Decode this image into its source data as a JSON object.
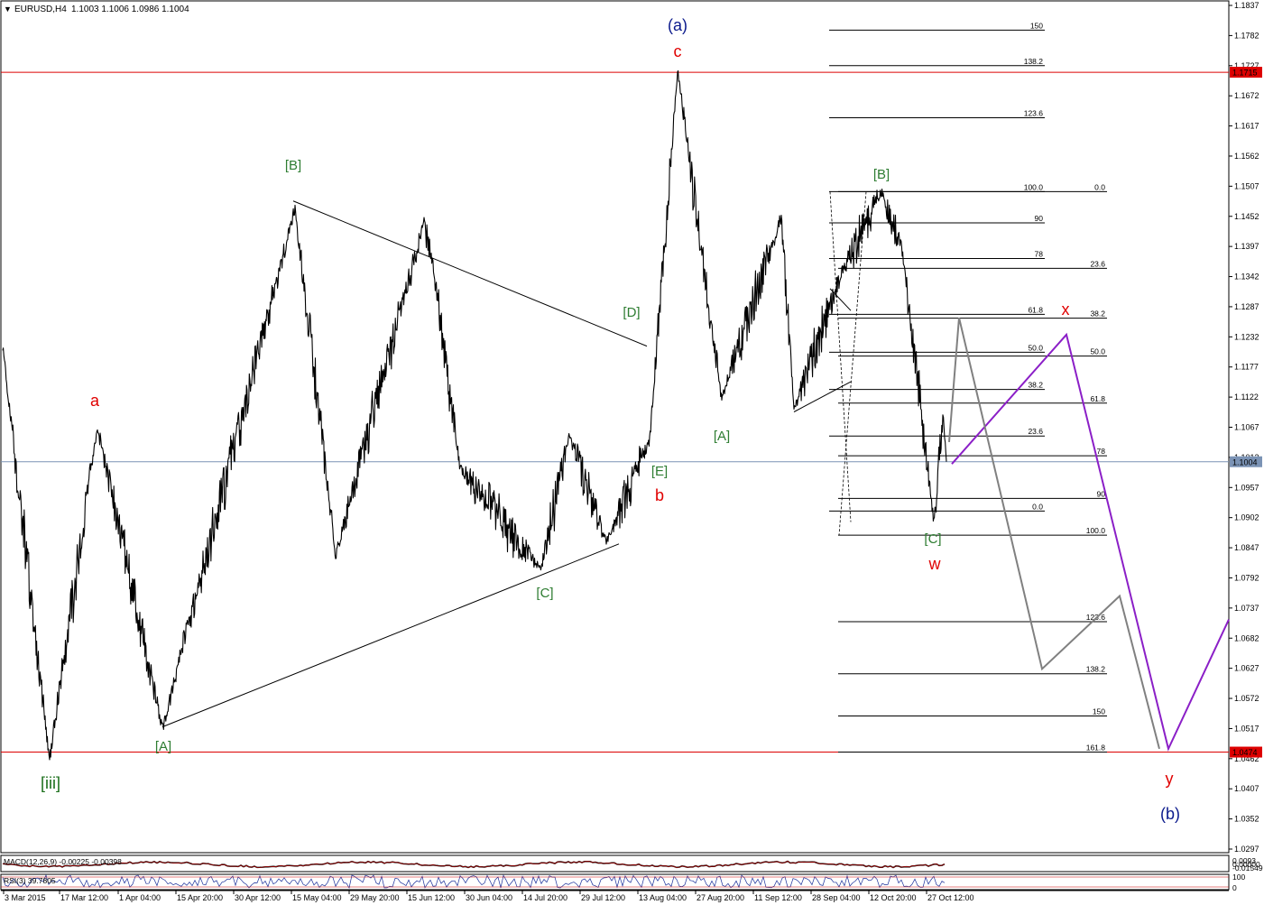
{
  "chart_title": {
    "symbol": "EURUSD,H4",
    "ohlc": "1.1003 1.1006 1.0986 1.1004"
  },
  "chart_data": {
    "type": "line",
    "symbol": "EURUSD",
    "timeframe": "H4",
    "last_price": 1.1004,
    "ylim": [
      1.0297,
      1.1837
    ],
    "price_ticks": [
      "1.1837",
      "1.1782",
      "1.1727",
      "1.1672",
      "1.1617",
      "1.1562",
      "1.1507",
      "1.1452",
      "1.1397",
      "1.1342",
      "1.1287",
      "1.1232",
      "1.1177",
      "1.1122",
      "1.1067",
      "1.1012",
      "1.0957",
      "1.0902",
      "1.0847",
      "1.0792",
      "1.0737",
      "1.0682",
      "1.0627",
      "1.0572",
      "1.0517",
      "1.0462",
      "1.0407",
      "1.0352",
      "1.0297"
    ],
    "date_ticks": [
      "3 Mar 2015",
      "17 Mar 12:00",
      "1 Apr 04:00",
      "15 Apr 20:00",
      "30 Apr 12:00",
      "15 May 04:00",
      "29 May 20:00",
      "15 Jun 12:00",
      "30 Jun 04:00",
      "14 Jul 20:00",
      "29 Jul 12:00",
      "13 Aug 04:00",
      "27 Aug 20:00",
      "11 Sep 12:00",
      "28 Sep 04:00",
      "12 Oct 20:00",
      "27 Oct 12:00"
    ],
    "series": [
      {
        "x": [
          "3 Mar 2015",
          "13 Mar",
          "27 Mar",
          "14 Apr",
          "25 Apr",
          "14 May",
          "27 May",
          "18 Jun",
          "26 Jun",
          "8 Jul",
          "20 Jul",
          "27 Jul",
          "4 Aug",
          "24 Aug",
          "28 Aug",
          "14 Sep",
          "20 Sep",
          "26 Sep",
          "12 Oct",
          "19 Oct",
          "26 Oct",
          "28 Oct",
          "30 Oct"
        ],
        "values": [
          1.1213,
          1.0462,
          1.1066,
          1.0517,
          1.1467,
          1.0832,
          1.144,
          1.138,
          1.099,
          1.081,
          1.105,
          1.086,
          1.104,
          1.1715,
          1.112,
          1.145,
          1.11,
          1.135,
          1.1495,
          1.139,
          1.0897,
          1.108,
          1.1004
        ]
      }
    ],
    "horizontal_lines": [
      {
        "price": 1.1715,
        "label": "1.1715",
        "color": "#dd0000"
      },
      {
        "price": 1.0474,
        "label": "1.0474",
        "color": "#dd0000"
      },
      {
        "price": 1.1004,
        "label": "1.1004",
        "color": "#7b93b5"
      }
    ],
    "wave_labels": [
      {
        "text": "(a)",
        "color": "#0b1a8c"
      },
      {
        "text": "c",
        "color": "#e00000"
      },
      {
        "text": "a",
        "color": "#e00000"
      },
      {
        "text": "b",
        "color": "#e00000"
      },
      {
        "text": "[iii]",
        "color": "#1a6e1a"
      },
      {
        "text": "[B]",
        "color": "#2e7d32"
      },
      {
        "text": "[A]",
        "color": "#2e7d32"
      },
      {
        "text": "[C]",
        "color": "#2e7d32"
      },
      {
        "text": "[D]",
        "color": "#2e7d32"
      },
      {
        "text": "[E]",
        "color": "#2e7d32"
      },
      {
        "text": "[A]",
        "color": "#2e7d32"
      },
      {
        "text": "[B]",
        "color": "#2e7d32"
      },
      {
        "text": "[C]",
        "color": "#2e7d32"
      },
      {
        "text": "w",
        "color": "#e00000"
      },
      {
        "text": "x",
        "color": "#e00000"
      },
      {
        "text": "y",
        "color": "#e00000"
      },
      {
        "text": "(b)",
        "color": "#0b1a8c"
      }
    ],
    "fibonacci": [
      {
        "label": "150",
        "price": 1.1792
      },
      {
        "label": "138.2",
        "price": 1.1727
      },
      {
        "label": "123.6",
        "price": 1.1632
      },
      {
        "label": "100.0",
        "price": 1.1497
      },
      {
        "label": "90",
        "price": 1.144
      },
      {
        "label": "78",
        "price": 1.1375
      },
      {
        "label": "61.8",
        "price": 1.1273
      },
      {
        "label": "50.0",
        "price": 1.1204
      },
      {
        "label": "38.2",
        "price": 1.1136
      },
      {
        "label": "23.6",
        "price": 1.1051
      },
      {
        "label": "0.0",
        "price": 1.0914
      },
      {
        "label": "0.0",
        "price": 1.1497
      },
      {
        "label": "23.6",
        "price": 1.1357
      },
      {
        "label": "38.2",
        "price": 1.1266
      },
      {
        "label": "50.0",
        "price": 1.1197
      },
      {
        "label": "61.8",
        "price": 1.1111
      },
      {
        "label": "78",
        "price": 1.1015
      },
      {
        "label": "90",
        "price": 1.0937
      },
      {
        "label": "100.0",
        "price": 1.087
      },
      {
        "label": "123.6",
        "price": 1.0712
      },
      {
        "label": "138.2",
        "price": 1.0617
      },
      {
        "label": "150",
        "price": 1.054
      },
      {
        "label": "161.8",
        "price": 1.0474
      }
    ]
  },
  "macd": {
    "label": "MACD(12,26,9) -0.00225 -0.00398",
    "ticks": [
      "0.0093",
      "0.00000",
      "-0.01549"
    ]
  },
  "rsi": {
    "label": "RSI(3) 39.7805",
    "ticks": [
      "100",
      "0"
    ]
  },
  "colors": {
    "price": "#000000",
    "support_resistance": "#dd0000",
    "current_price": "#7b93b5",
    "projection_primary": "#8b1fc7",
    "projection_alt": "#808080"
  }
}
